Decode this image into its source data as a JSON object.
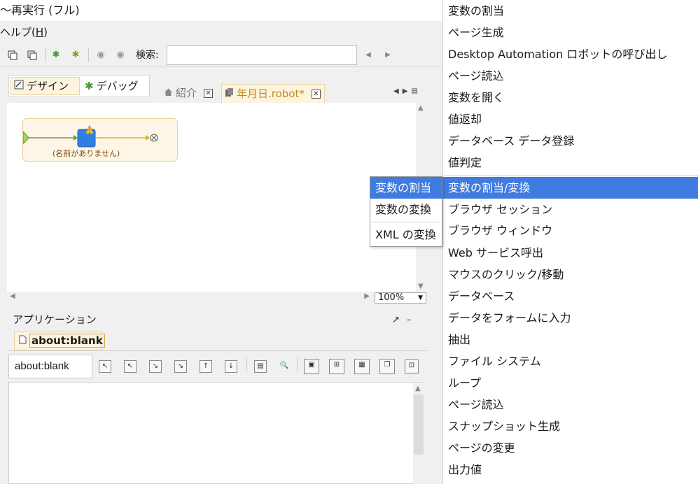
{
  "window": {
    "title_fragment": "〜再実行 (フル)",
    "menu_fragment_prefix": "ヘルプ(",
    "menu_fragment_key": "H",
    "menu_fragment_suffix": ")"
  },
  "toolbar": {
    "search_label": "検索:",
    "search_value": ""
  },
  "modes": {
    "design_label": "デザイン",
    "debug_label": "デバッグ"
  },
  "editor_tabs": {
    "intro_label": "紹介",
    "robot_label": "年月日.robot*"
  },
  "canvas": {
    "step_label": "(名前がありません)",
    "zoom": "100%"
  },
  "application_panel": {
    "title": "アプリケーション",
    "tab_label": "about:blank",
    "url_value": "about:blank"
  },
  "right_menu": {
    "items": [
      "変数の割当",
      "ページ生成",
      "Desktop Automation ロボットの呼び出し",
      "ページ読込",
      "変数を開く",
      "値返却",
      "データベース データ登録",
      "値判定",
      "変数の割当/変換",
      "ブラウザ セッション",
      "ブラウザ ウィンドウ",
      "Web サービス呼出",
      "マウスのクリック/移動",
      "データベース",
      "データをフォームに入力",
      "抽出",
      "ファイル システム",
      "ループ",
      "ページ読込",
      "スナップショット生成",
      "ページの変更",
      "出力値"
    ],
    "selected_index": 8
  },
  "submenu": {
    "items": [
      "変数の割当",
      "変数の変換",
      "XML の変換"
    ],
    "selected_index": 0
  },
  "colors": {
    "selection": "#3f7be0",
    "tab_highlight": "#fdf4df",
    "flow_border": "#e9cf94"
  }
}
